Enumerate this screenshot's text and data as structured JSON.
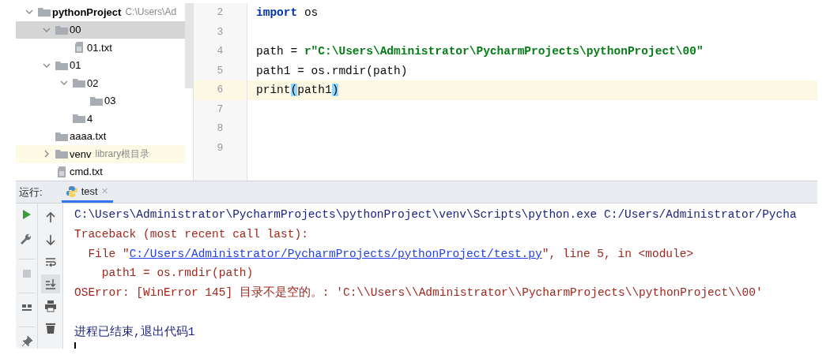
{
  "project_tree": {
    "items": [
      {
        "label": "pythonProject",
        "hint": "C:\\Users\\Ad",
        "kind": "folder",
        "expanded": true,
        "selected": false,
        "children": [
          {
            "label": "00",
            "kind": "folder",
            "expanded": true,
            "selected": true,
            "children": [
              {
                "label": "01.txt",
                "kind": "file",
                "selected": false
              }
            ]
          },
          {
            "label": "01",
            "kind": "folder",
            "expanded": true,
            "selected": false,
            "children": [
              {
                "label": "02",
                "kind": "folder",
                "expanded": true,
                "selected": false,
                "children": [
                  {
                    "label": "03",
                    "kind": "folder",
                    "selected": false
                  }
                ]
              },
              {
                "label": "4",
                "kind": "folder",
                "selected": false
              }
            ]
          },
          {
            "label": "aaaa.txt",
            "kind": "folder",
            "selected": false
          },
          {
            "label": "venv",
            "hint": "library根目录",
            "kind": "folder",
            "expanded": false,
            "selected": false,
            "highlighted": true
          },
          {
            "label": "cmd.txt",
            "kind": "file",
            "selected": false
          }
        ]
      }
    ]
  },
  "editor": {
    "lines": [
      {
        "number": "2",
        "current": false,
        "tokens": [
          {
            "text": "import",
            "kind": "keyword"
          },
          {
            "text": " os",
            "kind": "plain"
          }
        ]
      },
      {
        "number": "3",
        "current": false
      },
      {
        "number": "4",
        "current": false,
        "tokens": [
          {
            "text": "path = ",
            "kind": "plain"
          },
          {
            "text": "r\"C:\\Users\\Administrator\\PycharmProjects\\pythonProject\\00\"",
            "kind": "string"
          }
        ]
      },
      {
        "number": "5",
        "current": false,
        "tokens": [
          {
            "text": "path1 = os.rmdir(path)",
            "kind": "plain"
          }
        ]
      },
      {
        "number": "6",
        "current": true,
        "tokens": [
          {
            "text": "print",
            "kind": "plain"
          },
          {
            "text": "(",
            "kind": "brace"
          },
          {
            "text": "path1",
            "kind": "plain"
          },
          {
            "text": ")",
            "kind": "brace"
          }
        ]
      },
      {
        "number": "7",
        "current": false
      },
      {
        "number": "8",
        "current": false
      },
      {
        "number": "9",
        "current": false
      }
    ]
  },
  "run_panel": {
    "label": "运行:",
    "tabs": [
      {
        "label": "test",
        "close": "×",
        "selected": true
      }
    ],
    "side_tools": [
      {
        "kind": "run"
      },
      {
        "kind": "wrench"
      },
      {
        "kind": "stop"
      },
      {
        "kind": "layout"
      },
      {
        "kind": "pin"
      }
    ],
    "console_tools": [
      {
        "kind": "up",
        "selected": false
      },
      {
        "kind": "down",
        "selected": false
      },
      {
        "kind": "wrap",
        "selected": false
      },
      {
        "kind": "scroll-end",
        "selected": true
      },
      {
        "kind": "print",
        "selected": false
      },
      {
        "kind": "trash",
        "selected": false
      }
    ],
    "console": [
      {
        "kind": "output",
        "tokens": [
          {
            "text": "C:\\Users\\Administrator\\PycharmProjects\\pythonProject\\venv\\Scripts\\python.exe C:/Users/Administrator/Pycha",
            "kind": "normal"
          }
        ]
      },
      {
        "kind": "output",
        "tokens": [
          {
            "text": "Traceback (most recent call last):",
            "kind": "error"
          }
        ]
      },
      {
        "kind": "output",
        "tokens": [
          {
            "text": "  File \"",
            "kind": "error"
          },
          {
            "text": "C:/Users/Administrator/PycharmProjects/pythonProject/test.py",
            "kind": "link"
          },
          {
            "text": "\", line 5, in <module>",
            "kind": "error"
          }
        ]
      },
      {
        "kind": "output",
        "tokens": [
          {
            "text": "    path1 = os.rmdir(path)",
            "kind": "error"
          }
        ]
      },
      {
        "kind": "output",
        "tokens": [
          {
            "text": "OSError: [WinError 145] 目录不是空的。: 'C:\\\\Users\\\\Administrator\\\\PycharmProjects\\\\pythonProject\\\\00'",
            "kind": "error"
          }
        ]
      },
      {
        "kind": "blank"
      },
      {
        "kind": "output",
        "tokens": [
          {
            "text": "进程已结束,退出代码1",
            "kind": "normal"
          }
        ]
      }
    ]
  }
}
